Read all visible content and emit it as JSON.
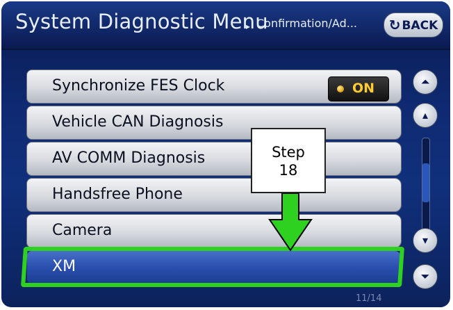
{
  "header": {
    "title": "System Diagnostic Menu",
    "arrow": "▸",
    "breadcrumb": "Confirmation/Ad...",
    "back_label": "BACK",
    "back_icon": "↻"
  },
  "menu": {
    "items": [
      {
        "label": "Synchronize FES Clock"
      },
      {
        "label": "Vehicle CAN Diagnosis"
      },
      {
        "label": "AV COMM Diagnosis"
      },
      {
        "label": "Handsfree Phone"
      },
      {
        "label": "Camera"
      },
      {
        "label": "XM"
      }
    ],
    "on_indicator": "ON",
    "selected_index": 5
  },
  "annotation": {
    "step_word": "Step",
    "step_number": "18"
  },
  "scroll": {
    "page_up_icon": "⏶",
    "up_icon": "▴",
    "down_icon": "▾",
    "page_down_icon": "⏷",
    "page_indicator": "11/14"
  },
  "colors": {
    "highlight": "#2ed11f",
    "on_text": "#ffcc33"
  }
}
